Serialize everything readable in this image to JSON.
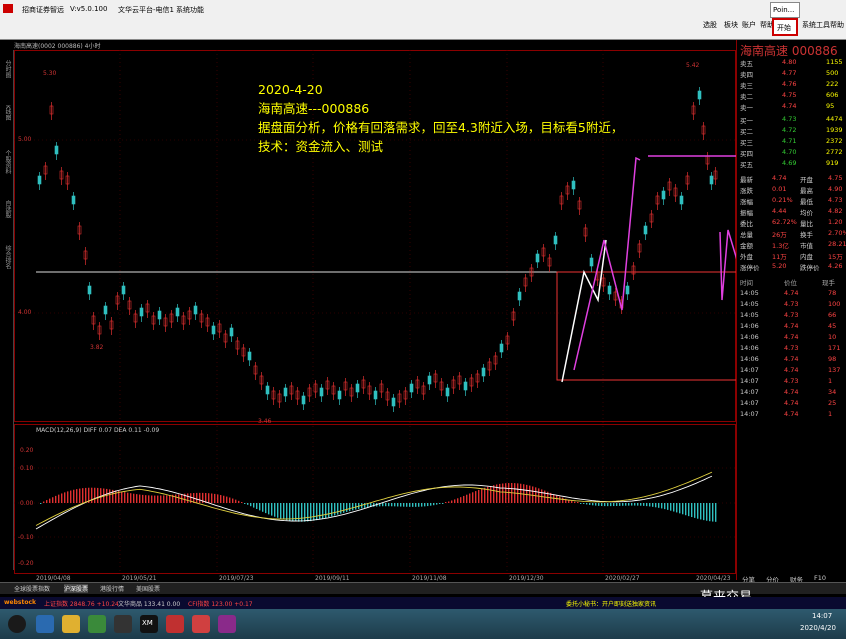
{
  "titlebar": {
    "app": "招商证券智远",
    "version": "V:v5.0.100",
    "menus": [
      "文华云平台-电信1",
      "系统功能"
    ],
    "right_items": [
      "选股",
      "板块",
      "账户",
      "帮助"
    ],
    "point_label": "Poin...",
    "start_label": "开始",
    "sys_tools": "系统工具",
    "help": "帮助"
  },
  "chart_header": {
    "code_line": "海南高速(0002 000886)  4小时"
  },
  "left_tabs": [
    "分时图",
    "K线图",
    "个股资料",
    "自选股",
    "综合排名"
  ],
  "annotation": {
    "date": "2020-4-20",
    "stock": "海南高速---000886",
    "line1": "据盘面分析，价格有回落需求，回至4.3附近入场，目标看5附近，",
    "line2": "技术：资金流入、测试"
  },
  "price_labels": {
    "high_left": "5.30",
    "low_mid": "3.82",
    "low_bottom": "3.46",
    "peak_right": "5.42",
    "y1": "5.00",
    "y2": "4.00"
  },
  "macd_label": "MACD(12,26,9)  DIFF 0.07  DEA 0.11  -0.09",
  "macd_y": [
    "0.20",
    "0.10",
    "0.00",
    "-0.10",
    "-0.20"
  ],
  "dates": [
    "2019/04/08",
    "2019/05/21",
    "2019/07/23",
    "2019/09/11",
    "2019/11/08",
    "2019/12/30",
    "2020/02/27",
    "2020/04/23"
  ],
  "quote": {
    "title": "海南高速  000886",
    "sells": [
      {
        "label": "卖五",
        "price": "4.80",
        "vol": "1155"
      },
      {
        "label": "卖四",
        "price": "4.77",
        "vol": "500"
      },
      {
        "label": "卖三",
        "price": "4.76",
        "vol": "222"
      },
      {
        "label": "卖二",
        "price": "4.75",
        "vol": "606"
      },
      {
        "label": "卖一",
        "price": "4.74",
        "vol": "95"
      }
    ],
    "buys": [
      {
        "label": "买一",
        "price": "4.73",
        "vol": "4474"
      },
      {
        "label": "买二",
        "price": "4.72",
        "vol": "1939"
      },
      {
        "label": "买三",
        "price": "4.71",
        "vol": "2372"
      },
      {
        "label": "买四",
        "price": "4.70",
        "vol": "2772"
      },
      {
        "label": "买五",
        "price": "4.69",
        "vol": "919"
      }
    ],
    "stats": [
      {
        "a": "最新",
        "av": "4.74",
        "b": "开盘",
        "bv": "4.75"
      },
      {
        "a": "涨跌",
        "av": "0.01",
        "b": "最高",
        "bv": "4.90"
      },
      {
        "a": "涨幅",
        "av": "0.21%",
        "b": "最低",
        "bv": "4.73"
      },
      {
        "a": "振幅",
        "av": "4.44",
        "b": "均价",
        "bv": "4.82"
      },
      {
        "a": "委比",
        "av": "62.72%",
        "b": "量比",
        "bv": "1.20"
      },
      {
        "a": "总量",
        "av": "26万",
        "b": "换手",
        "bv": "2.70%"
      },
      {
        "a": "金额",
        "av": "1.3亿",
        "b": "市值",
        "bv": "28.21"
      },
      {
        "a": "外盘",
        "av": "11万",
        "b": "内盘",
        "bv": "15万"
      },
      {
        "a": "涨停价",
        "av": "5.20",
        "b": "跌停价",
        "bv": "4.26"
      }
    ],
    "trades_header": [
      "时间",
      "价位",
      "现手"
    ],
    "trades": [
      {
        "t": "14:05",
        "p": "4.74",
        "v": "78"
      },
      {
        "t": "14:05",
        "p": "4.73",
        "v": "100"
      },
      {
        "t": "14:05",
        "p": "4.73",
        "v": "66"
      },
      {
        "t": "14:06",
        "p": "4.74",
        "v": "45"
      },
      {
        "t": "14:06",
        "p": "4.74",
        "v": "10"
      },
      {
        "t": "14:06",
        "p": "4.73",
        "v": "171"
      },
      {
        "t": "14:06",
        "p": "4.74",
        "v": "98"
      },
      {
        "t": "14:07",
        "p": "4.74",
        "v": "137"
      },
      {
        "t": "14:07",
        "p": "4.73",
        "v": "1"
      },
      {
        "t": "14:07",
        "p": "4.74",
        "v": "34"
      },
      {
        "t": "14:07",
        "p": "4.74",
        "v": "25"
      },
      {
        "t": "14:07",
        "p": "4.74",
        "v": "1"
      }
    ],
    "bottom_tabs": [
      "分笔",
      "分价",
      "财务",
      "F10"
    ]
  },
  "bottom_tabs": [
    "全球股票指数",
    "沪深股票",
    "港股行情",
    "美国股票"
  ],
  "status": {
    "brand": "webstock",
    "sh": "上证指数  2848.76  +10.24",
    "other": "文华商品  133.41  0.00",
    "cfi": "CFI指数  123.00  +0.17",
    "notice": "委托小秘书：开户即刻送独家资讯",
    "clock": "14:07",
    "date": "2020/4/20"
  },
  "watermark": "慕来交易",
  "colors": {
    "up": "#e03030",
    "down": "#30c0c0",
    "annotation": "#ffff00",
    "arrow": "#e040e0"
  }
}
